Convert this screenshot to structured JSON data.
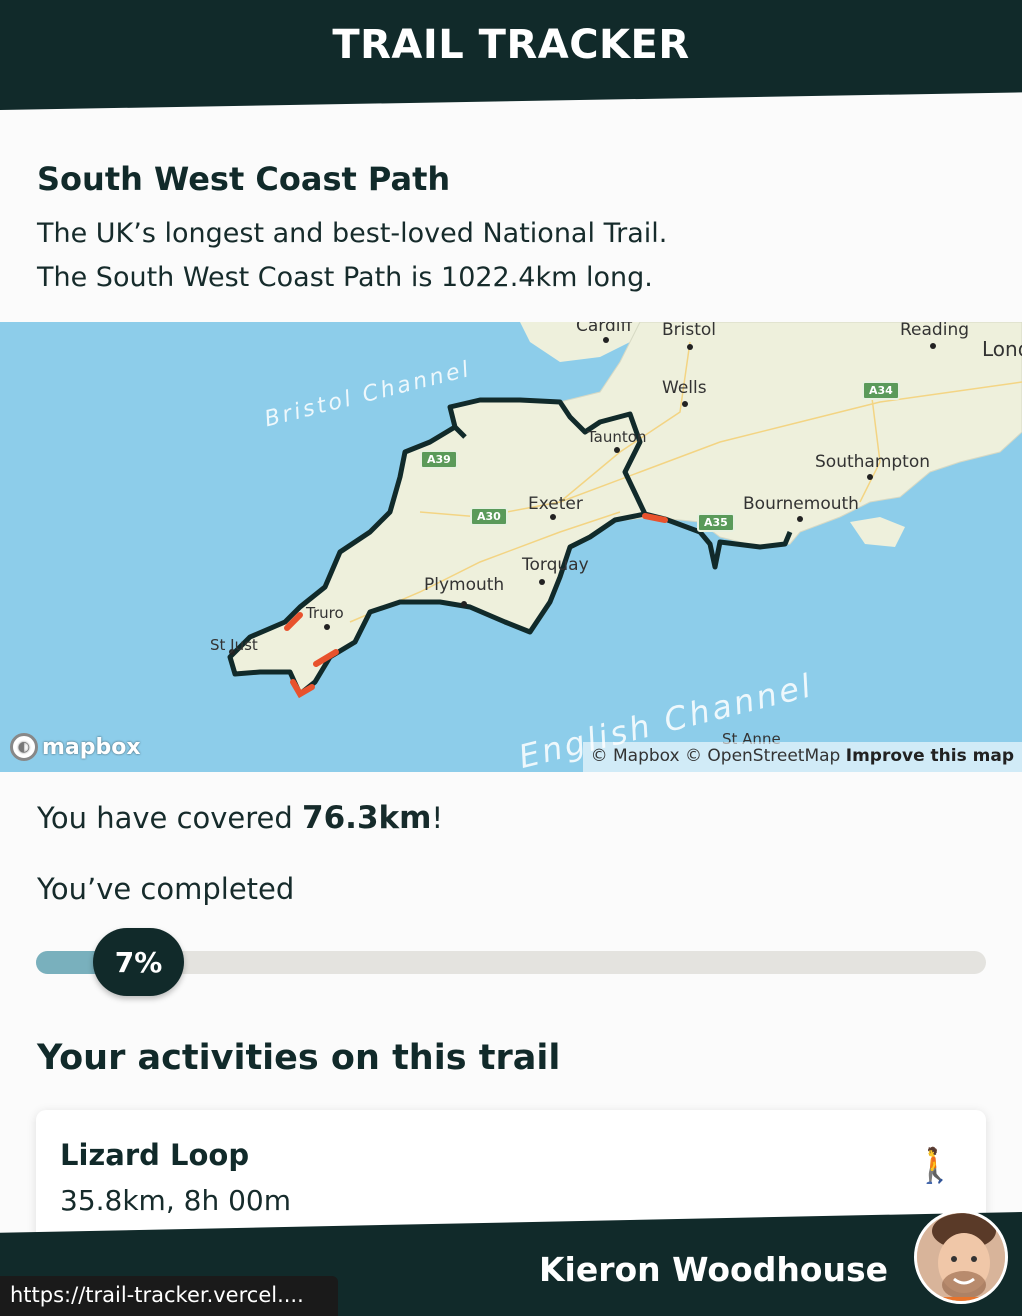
{
  "header": {
    "title": "TRAIL TRACKER"
  },
  "trail": {
    "name": "South West Coast Path",
    "description_line1": "The UK’s longest and best-loved National Trail.",
    "description_line2": "The South West Coast Path is 1022.4km long."
  },
  "map": {
    "places": {
      "cardiff": "Cardiff",
      "bristol": "Bristol",
      "reading": "Reading",
      "london": "Lond",
      "wells": "Wells",
      "taunton": "Taunton",
      "southampton": "Southampton",
      "exeter": "Exeter",
      "bournemouth": "Bournemouth",
      "torquay": "Torquay",
      "plymouth": "Plymouth",
      "truro": "Truro",
      "st_just": "St Just",
      "st_anne": "St Anne"
    },
    "seas": {
      "bristol_channel": "Bristol Channel",
      "english_channel": "English Channel"
    },
    "roads": {
      "a34": "A34",
      "a39": "A39",
      "a30": "A30",
      "a35": "A35"
    },
    "logo": "mapbox",
    "attribution": {
      "mapbox": "© Mapbox",
      "osm": "© OpenStreetMap",
      "improve": "Improve this map"
    },
    "colors": {
      "sea": "#8dcdea",
      "land": "#eef0dc",
      "trail": "#112a2a",
      "covered": "#e8522d"
    }
  },
  "progress": {
    "covered_prefix": "You have covered ",
    "covered_value": "76.3km",
    "covered_suffix": "!",
    "completed_label": "You’ve completed",
    "percent_label": "7%",
    "percent": 7
  },
  "activities": {
    "title": "Your activities on this trail",
    "items": [
      {
        "name": "Lizard Loop",
        "stats": "35.8km, 8h 00m",
        "icon": "walking-person-icon"
      }
    ]
  },
  "footer": {
    "user_name": "Kieron Woodhouse"
  },
  "status_url": "https://trail-tracker.vercel...."
}
